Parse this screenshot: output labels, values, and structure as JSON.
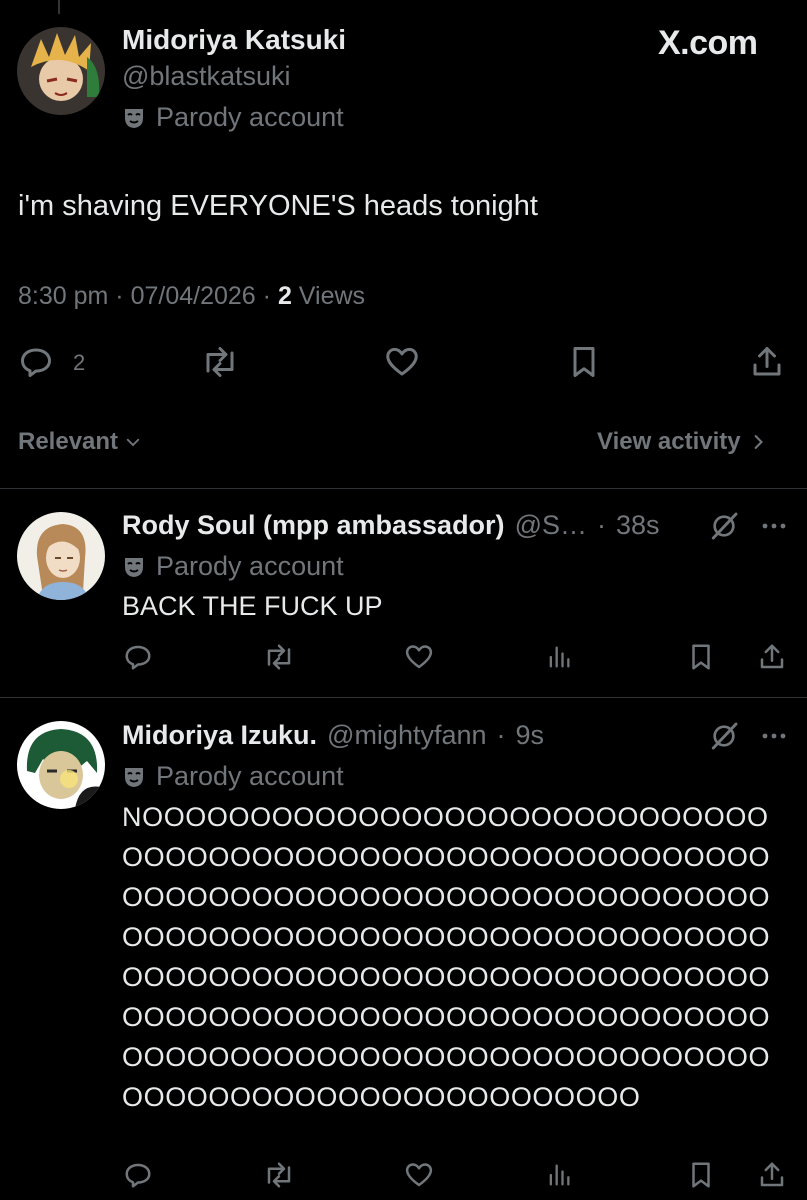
{
  "main_post": {
    "author_name": "Midoriya Katsuki",
    "handle": "@blastkatsuki",
    "parody_label": "Parody account",
    "site_label": "X.com",
    "text": "i'm shaving EVERYONE'S heads tonight",
    "time": "8:30 pm",
    "date": "07/04/2026",
    "views_count": "2",
    "views_label": "Views",
    "reply_count": "2"
  },
  "sort": {
    "label": "Relevant",
    "view_activity_label": "View activity"
  },
  "replies": [
    {
      "author_name": "Rody Soul (mpp ambassador)",
      "handle": "@S…",
      "time": "38s",
      "parody_label": "Parody account",
      "text": "BACK THE FUCK UP"
    },
    {
      "author_name": "Midoriya Izuku.",
      "handle": "@mightyfann",
      "time": "9s",
      "parody_label": "Parody account",
      "text": "NOOOOOOOOOOOOOOOOOOOOOOOOOOOOOOOOOOOOOOOOOOOOOOOOOOOOOOOOOOOOOOOOOOOOOOOOOOOOOOOOOOOOOOOOOOOOOOOOOOOOOOOOOOOOOOOOOOOOOOOOOOOOOOOOOOOOOOOOOOOOOOOOOOOOOOOOOOOOOOOOOOOOOOOOOOOOOOOOOOOOOOOOOOOOOOOOOOOOOOOOOOOOOOOOOOOOOOOOOOOOOOOOOOOOOOOOO"
    }
  ],
  "colors": {
    "background": "#000000",
    "text_primary": "#e7e9ea",
    "text_secondary": "#71767b",
    "divider": "#2f3336"
  }
}
